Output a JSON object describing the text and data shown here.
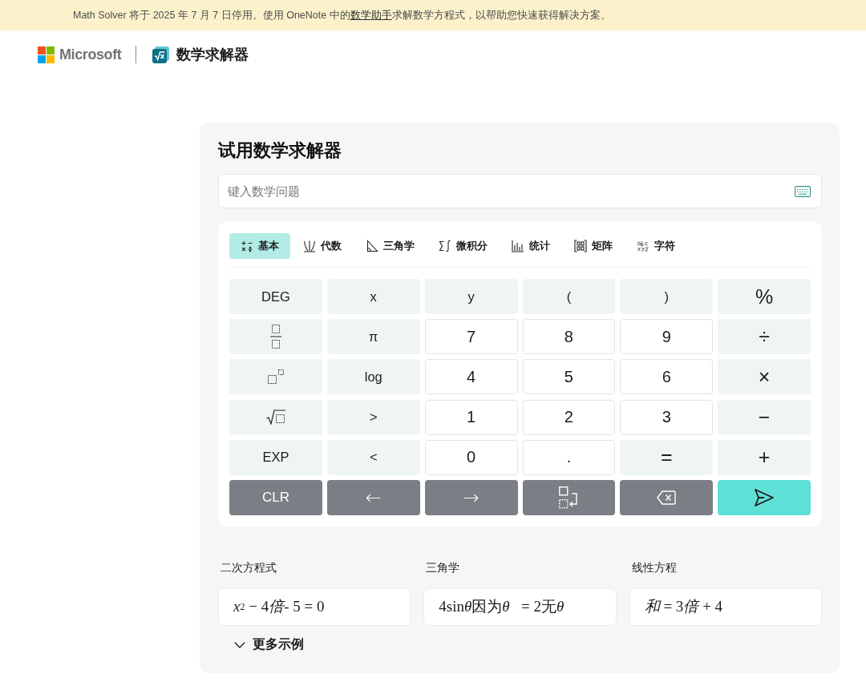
{
  "notice": {
    "text_before": "Math Solver 将于 2025 年 7 月 7 日停用。使用 OneNote 中的",
    "link": "数学助手",
    "text_after": "求解数学方程式，以帮助您快速获得解决方案。"
  },
  "header": {
    "brand": "Microsoft",
    "app_name": "数学求解器"
  },
  "solver": {
    "title": "试用数学求解器",
    "input": {
      "placeholder": "键入数学问题"
    },
    "keypad": {
      "tabs": [
        {
          "kind": "basic",
          "label": "基本",
          "selected": true
        },
        {
          "kind": "algebra",
          "label": "代数",
          "selected": false
        },
        {
          "kind": "trigonometry",
          "label": "三角学",
          "selected": false
        },
        {
          "kind": "calculus",
          "label": "微积分",
          "selected": false
        },
        {
          "kind": "statistics",
          "label": "统计",
          "selected": false
        },
        {
          "kind": "matrix",
          "label": "矩阵",
          "selected": false
        },
        {
          "kind": "characters",
          "label": "字符",
          "selected": false
        }
      ],
      "keys": [
        [
          {
            "kind": "function",
            "label": "DEG"
          },
          {
            "kind": "function",
            "label": "x"
          },
          {
            "kind": "function",
            "label": "y"
          },
          {
            "kind": "function",
            "label": "("
          },
          {
            "kind": "function",
            "label": ")"
          },
          {
            "kind": "operator",
            "label": "%"
          }
        ],
        [
          {
            "kind": "fraction"
          },
          {
            "kind": "function",
            "label": "π"
          },
          {
            "kind": "number",
            "label": "7"
          },
          {
            "kind": "number",
            "label": "8"
          },
          {
            "kind": "number",
            "label": "9"
          },
          {
            "kind": "operator",
            "label": "÷"
          }
        ],
        [
          {
            "kind": "power"
          },
          {
            "kind": "function",
            "label": "log"
          },
          {
            "kind": "number",
            "label": "4"
          },
          {
            "kind": "number",
            "label": "5"
          },
          {
            "kind": "number",
            "label": "6"
          },
          {
            "kind": "operator",
            "label": "×"
          }
        ],
        [
          {
            "kind": "root"
          },
          {
            "kind": "function",
            "label": ">"
          },
          {
            "kind": "number",
            "label": "1"
          },
          {
            "kind": "number",
            "label": "2"
          },
          {
            "kind": "number",
            "label": "3"
          },
          {
            "kind": "operator",
            "label": "−"
          }
        ],
        [
          {
            "kind": "function",
            "label": "EXP"
          },
          {
            "kind": "function",
            "label": "<"
          },
          {
            "kind": "number",
            "label": "0"
          },
          {
            "kind": "number",
            "label": "."
          },
          {
            "kind": "operator",
            "label": "="
          },
          {
            "kind": "operator",
            "label": "+"
          }
        ],
        [
          {
            "kind": "action",
            "label": "CLR"
          },
          {
            "kind": "arrow",
            "label": "←"
          },
          {
            "kind": "arrow",
            "label": "→"
          },
          {
            "kind": "swap"
          },
          {
            "kind": "erase"
          },
          {
            "kind": "send"
          }
        ]
      ]
    },
    "examples": [
      {
        "category": "二次方程式",
        "expression": [
          {
            "kind": "variable",
            "text": "x"
          },
          {
            "kind": "exponent",
            "text": "2"
          },
          {
            "kind": "text",
            "text": " − 4"
          },
          {
            "kind": "variable",
            "text": "倍"
          },
          {
            "kind": "text",
            "text": "- 5 = 0"
          }
        ]
      },
      {
        "category": "三角学",
        "expression": [
          {
            "kind": "text",
            "text": "4sin"
          },
          {
            "kind": "variable",
            "text": "θ"
          },
          {
            "kind": "text",
            "text": "因为"
          },
          {
            "kind": "variable",
            "text": "θ"
          },
          {
            "kind": "text",
            "text": "   = 2无"
          },
          {
            "kind": "variable",
            "text": "θ"
          }
        ]
      },
      {
        "category": "线性方程",
        "expression": [
          {
            "kind": "variable",
            "text": "和"
          },
          {
            "kind": "text",
            "text": " = 3"
          },
          {
            "kind": "variable",
            "text": "倍"
          },
          {
            "kind": "text",
            "text": " + 4"
          }
        ]
      }
    ],
    "more_examples": "更多示例"
  }
}
